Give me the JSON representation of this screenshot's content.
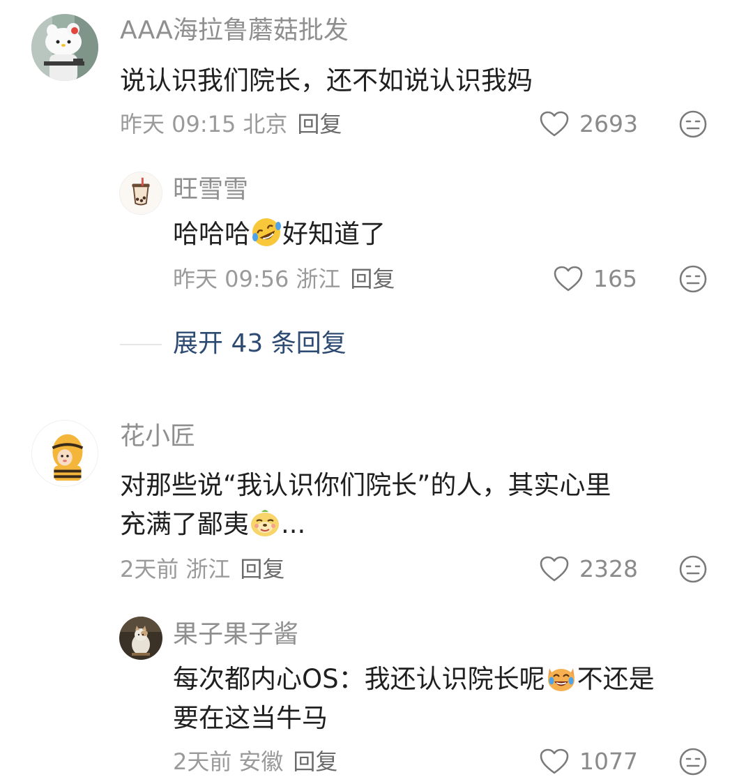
{
  "comments": [
    {
      "user": "AAA海拉鲁蘑菇批发",
      "text": "说认识我们院长，还不如说认识我妈",
      "time": "昨天 09:15",
      "location": "北京",
      "reply_label": "回复",
      "likes": "2693",
      "avatar_icon": "hello-kitty-avatar",
      "replies": [
        {
          "user": "旺雪雪",
          "text_before": "哈哈哈",
          "emoji": "rofl-emoji",
          "text_after": "好知道了",
          "time": "昨天 09:56",
          "location": "浙江",
          "reply_label": "回复",
          "likes": "165",
          "avatar_icon": "bubble-tea-avatar"
        }
      ],
      "expand_label": "展开 43 条回复"
    },
    {
      "user": "花小匠",
      "text_line1": "对那些说“我认识你们院长”的人，其实心里",
      "text_line2_before": "充满了鄙夷",
      "emoji": "smug-dog-emoji",
      "text_line2_after": "...",
      "time": "2天前",
      "location": "浙江",
      "reply_label": "回复",
      "likes": "2328",
      "avatar_icon": "bee-costume-avatar",
      "replies": [
        {
          "user": "果子果子酱",
          "text_line1_before": "每次都内心OS：我还认识院长呢",
          "emoji": "laughing-cat-emoji",
          "text_line1_after": "不还是",
          "text_line2": "要在这当牛马",
          "time": "2天前",
          "location": "安徽",
          "reply_label": "回复",
          "likes": "1077",
          "avatar_icon": "cat-photo-avatar"
        }
      ]
    }
  ],
  "colors": {
    "expand_link": "#2d4a73",
    "meta": "#9a9a9a",
    "name": "#8f8f8f"
  }
}
